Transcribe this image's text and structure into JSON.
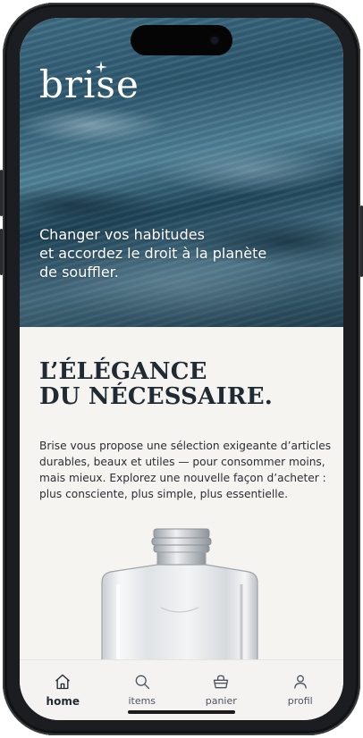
{
  "brand": {
    "logo_text": "brise"
  },
  "hero": {
    "tagline": "Changer vos habitudes\n et accordez le droit à la planète\nde souffler."
  },
  "intro": {
    "headline": "L’ÉLÉGANCE\nDU NÉCESSAIRE.",
    "body": "Brise vous propose une sélection exigeante d’articles durables, beaux et utiles — pour consommer moins, mais mieux. Explorez une nouvelle façon d’acheter : plus consciente, plus simple, plus essentielle."
  },
  "tabbar": {
    "items": [
      {
        "label": "home",
        "icon": "home-icon",
        "active": true
      },
      {
        "label": "items",
        "icon": "search-icon",
        "active": false
      },
      {
        "label": "panier",
        "icon": "basket-icon",
        "active": false
      },
      {
        "label": "profil",
        "icon": "user-icon",
        "active": false
      }
    ]
  },
  "colors": {
    "text_dark": "#1f2a33",
    "background": "#f5f4f1",
    "hero_blue": "#2b566d"
  }
}
